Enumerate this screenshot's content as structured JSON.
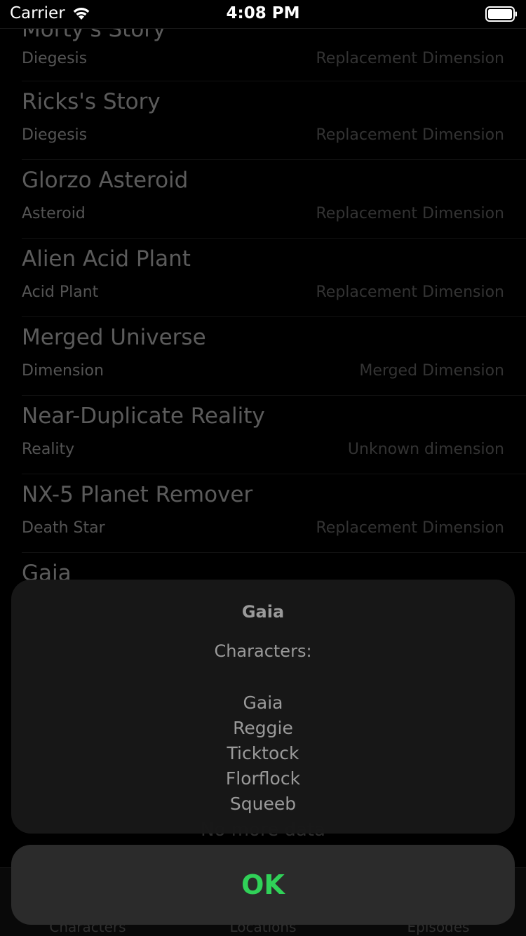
{
  "status_bar": {
    "carrier": "Carrier",
    "time": "4:08 PM"
  },
  "locations": [
    {
      "name": "Morty's Story",
      "type": "Diegesis",
      "dimension": "Replacement Dimension"
    },
    {
      "name": "Ricks's Story",
      "type": "Diegesis",
      "dimension": "Replacement Dimension"
    },
    {
      "name": "Glorzo Asteroid",
      "type": "Asteroid",
      "dimension": "Replacement Dimension"
    },
    {
      "name": "Alien Acid Plant",
      "type": "Acid Plant",
      "dimension": "Replacement Dimension"
    },
    {
      "name": "Merged Universe",
      "type": "Dimension",
      "dimension": "Merged Dimension"
    },
    {
      "name": "Near-Duplicate Reality",
      "type": "Reality",
      "dimension": "Unknown dimension"
    },
    {
      "name": "NX-5 Planet Remover",
      "type": "Death Star",
      "dimension": "Replacement Dimension"
    },
    {
      "name": "Gaia",
      "type": "",
      "dimension": ""
    }
  ],
  "footer": {
    "text": "No more data"
  },
  "tab_bar": {
    "tabs": [
      "Characters",
      "Locations",
      "Episodes"
    ]
  },
  "alert": {
    "title": "Gaia",
    "label": "Characters:",
    "characters": [
      "Gaia",
      "Reggie",
      "Ticktock",
      "Florflock",
      "Squeeb"
    ],
    "ok_label": "OK"
  },
  "colors": {
    "accent": "#30d158",
    "background": "#000000"
  }
}
